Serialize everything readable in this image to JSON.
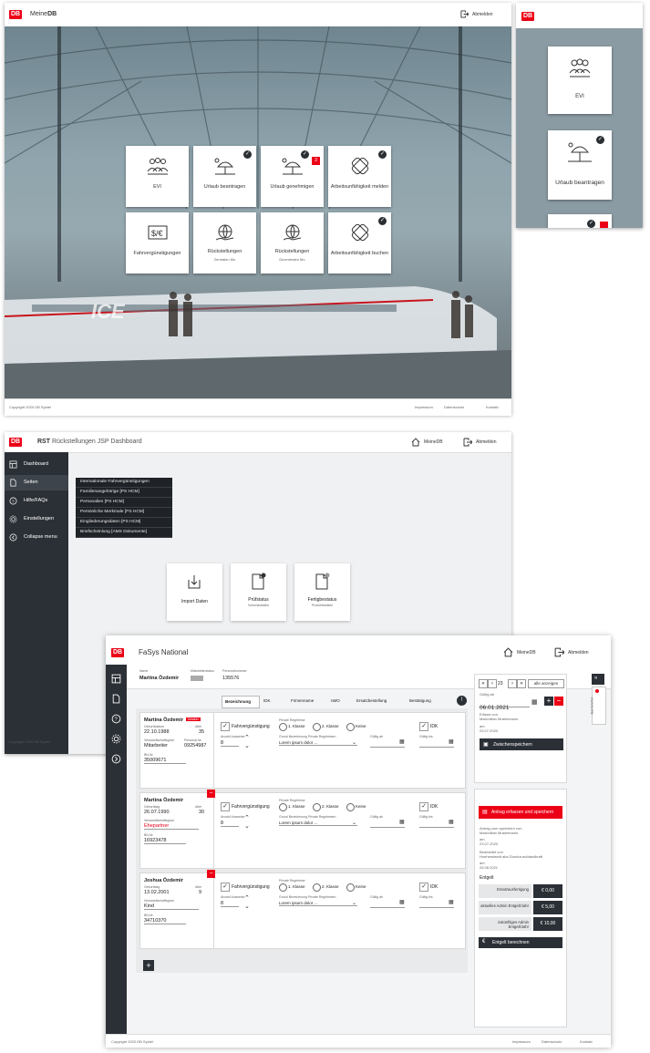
{
  "screen1": {
    "brand_plain": "Meine",
    "brand_bold": "DB",
    "logout": "Abmelden",
    "tiles": [
      {
        "label": "EVI",
        "sub": "",
        "icon": "people-group-icon",
        "check": false,
        "badge": ""
      },
      {
        "label": "Urlaub beantragen",
        "sub": "",
        "icon": "beach-umbrella-icon",
        "check": true,
        "badge": ""
      },
      {
        "label": "Urlaub genehmigen",
        "sub": "",
        "icon": "beach-umbrella-icon",
        "check": true,
        "badge": "3"
      },
      {
        "label": "Arbeitsunfähigkeit melden",
        "sub": "",
        "icon": "bandage-icon",
        "check": true,
        "badge": ""
      },
      {
        "label": "Fahrvergünstigungen",
        "sub": "",
        "icon": "currency-icon",
        "check": false,
        "badge": ""
      },
      {
        "label": "Rückstellungen",
        "sub": "Zentralen Mo",
        "icon": "globe-hand-icon",
        "check": false,
        "badge": ""
      },
      {
        "label": "Rückstellungen",
        "sub": "Dezentralen Mo",
        "icon": "globe-hand-icon",
        "check": false,
        "badge": ""
      },
      {
        "label": "Arbeitsunfähigkeit buchen",
        "sub": "",
        "icon": "bandage-icon",
        "check": true,
        "badge": ""
      }
    ],
    "train_text": "ICE",
    "copyright": "Copyright 2020 DB Systel",
    "footer_links": [
      "Impressum",
      "Datenschutz",
      "Kontakt"
    ]
  },
  "zoom": {
    "tile1": "EVI",
    "tile2": "Urlaub beantragen"
  },
  "screen2": {
    "brand": "RST",
    "title": "Rückstellungen JSP Dashboard",
    "meinedb": "MeineDB",
    "logout": "Abmelden",
    "sidebar": [
      {
        "label": "Dashboard",
        "icon": "dashboard-icon"
      },
      {
        "label": "Seiten",
        "icon": "page-icon"
      },
      {
        "label": "Hilfe/FAQs",
        "icon": "help-icon"
      },
      {
        "label": "Einstellungen",
        "icon": "gear-icon"
      },
      {
        "label": "Collapse menu",
        "icon": "collapse-icon"
      }
    ],
    "submenu": [
      "Internationale Fahrvergünstigungen",
      "Familienangehörige [PS HCM]",
      "Personalien [PS HCM]",
      "Persönliche Merkmale [PS HCM]",
      "Eingliederungsdaten [PS HCM]",
      "Briefscheinlung [AMS Dokumente]"
    ],
    "tiles": [
      {
        "label": "Import Daten",
        "sub": "",
        "icon": "import-icon"
      },
      {
        "label": "Prüfstatus",
        "sub": "Vorschaudaten",
        "icon": "document-icon"
      },
      {
        "label": "Fertigbestatus",
        "sub": "Produktivdaten",
        "icon": "document-icon"
      }
    ],
    "copyright": "Copyright 2020 DB Systel"
  },
  "screen3": {
    "title": "FaSys National",
    "meinedb": "MeineDB",
    "logout": "Abmelden",
    "person": {
      "name_label": "Name",
      "name": "Martina Özdemir",
      "pnr_label": "Personalnummer",
      "pnr": "135576",
      "status_label": "Mitarbeiterstatus"
    },
    "tabs": [
      "Bezeichnung",
      "IDK",
      "Firmenname",
      "nMO",
      "Ersatzbestellung",
      "Bestätigung"
    ],
    "rows": [
      {
        "name": "Martina Özdemir",
        "red_tag": "Inhaber",
        "geb_label": "Geburtsdatum",
        "geb": "22.10.1988",
        "age_label": "Alter",
        "age": "35",
        "verw_label": "Verwandtschaftsgrad",
        "verw": "Mitarbeiter",
        "pnr_label": "Personal-Nr.",
        "pnr": "09254987",
        "bn_label": "BN-Nr.",
        "bn": "35009671",
        "fahrv": "Fahrvergünstigung",
        "klasse_label": "Private Regelreise",
        "klassen": [
          "1. Klasse",
          "2. Klasse",
          "Keine"
        ],
        "anzahl_label": "Anzahl Ausweise",
        "anzahl": "8",
        "bez_label": "Grund Bezeichnung Private Regelreisen",
        "bez": "Lorem ipsum dolor ...",
        "gueltig_ab": "Gültig ab",
        "gueltig_bis": "Gültig bis",
        "idk": "IDK"
      },
      {
        "name": "Martina Özdemir",
        "red_tag": "",
        "geb_label": "Geburtstag",
        "geb": "26.07.1990",
        "age_label": "Alter",
        "age": "30",
        "verw_label": "Verwandtschaftsgrad",
        "verw": "Ehepartner",
        "pnr_label": "",
        "pnr": "",
        "bn_label": "BN-Nr.",
        "bn": "16923478",
        "fahrv": "Fahrvergünstigung",
        "klasse_label": "Private Regelreise",
        "klassen": [
          "1. Klasse",
          "2. Klasse",
          "Keine"
        ],
        "anzahl_label": "Anzahl Ausweise",
        "anzahl": "8",
        "bez_label": "Grund Bezeichnung Private Regelreisen",
        "bez": "Lorem ipsum dolor ...",
        "gueltig_ab": "Gültig ab",
        "gueltig_bis": "Gültig bis",
        "idk": "IDK"
      },
      {
        "name": "Joshua Özdemir",
        "red_tag": "",
        "geb_label": "Geburtstag",
        "geb": "13.02.2001",
        "age_label": "Alter",
        "age": "9",
        "verw_label": "Verwandtschaftsgrad",
        "verw": "Kind",
        "pnr_label": "",
        "pnr": "",
        "bn_label": "BN-Nr.",
        "bn": "34710370",
        "fahrv": "Fahrvergünstigung",
        "klasse_label": "Private Regelreise",
        "klassen": [
          "1. Klasse",
          "2. Klasse",
          "Keine"
        ],
        "anzahl_label": "Anzahl Ausweise",
        "anzahl": "8",
        "bez_label": "Grund Bezeichnung Private Regelreisen",
        "bez": "Lorem ipsum dolor ...",
        "gueltig_ab": "Gültig ab",
        "gueltig_bis": "Gültig bis",
        "idk": "IDK"
      }
    ],
    "right": {
      "page": "23",
      "show_all": "alle anzeigen",
      "gueltig_label": "Gültig ab",
      "gueltig_date": "06.01.2021",
      "erfasst_label": "Erfasst von",
      "erfasst_name": "Maximilian Mustermann",
      "am_label": "am",
      "am_date": "23.07.2020",
      "save_btn": "Zwischenspeichern",
      "red_btn": "Antrag erfassen und speichern",
      "info": [
        {
          "label": "Antrag zum speichern von",
          "val": "Maximilian Mustermann"
        },
        {
          "label": "am",
          "val": "23.07.2020"
        },
        {
          "label": "Bearbeitet von",
          "val": "Hoeherstaedt aka Durchzuschlandkraft"
        },
        {
          "label": "am",
          "val": "25.08.2021"
        }
      ],
      "entgelt_title": "Entgelt",
      "entgelt": [
        {
          "label": "Ersatzausfertigung",
          "value": "€ 0,00"
        },
        {
          "label": "aktuelles Admin Entgelt/Jahr",
          "value": "€ 5,00"
        },
        {
          "label": "zukünftiges Admin Entgelt/Jahr",
          "value": "€ 10,00"
        }
      ],
      "calc_btn": "Entgelt berechnen",
      "side_tab": "Barrierefrei"
    },
    "copyright": "Copyright 2020 DB Systel",
    "footer_links": [
      "Impressum",
      "Datenschutz",
      "Kontakt"
    ]
  }
}
